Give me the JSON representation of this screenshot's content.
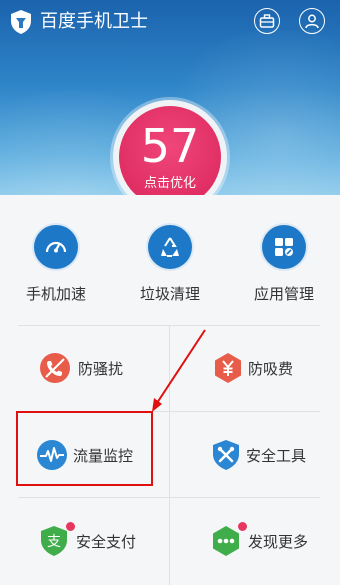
{
  "header": {
    "title": "百度手机卫士",
    "logo_icon": "shield-logo-icon",
    "toolbox_icon": "toolbox-icon",
    "profile_icon": "user-icon"
  },
  "score": {
    "value": "57",
    "label": "点击优化",
    "color": "#e0306a"
  },
  "tools": [
    {
      "label": "手机加速",
      "icon": "speedometer-icon"
    },
    {
      "label": "垃圾清理",
      "icon": "recycle-icon"
    },
    {
      "label": "应用管理",
      "icon": "app-grid-icon"
    }
  ],
  "features": [
    {
      "label": "防骚扰",
      "icon": "phone-block-icon",
      "color": "#e85c4a"
    },
    {
      "label": "防吸费",
      "icon": "yuan-hex-icon",
      "color": "#e85c4a"
    },
    {
      "label": "流量监控",
      "icon": "traffic-wave-icon",
      "color": "#2b86d3"
    },
    {
      "label": "安全工具",
      "icon": "tools-shield-icon",
      "color": "#2b86d3"
    },
    {
      "label": "安全支付",
      "icon": "payment-shield-icon",
      "color": "#3fae4a"
    },
    {
      "label": "发现更多",
      "icon": "more-hex-icon",
      "color": "#3fae4a"
    }
  ],
  "annotation": {
    "highlight": "流量监控",
    "color": "#e01010"
  }
}
